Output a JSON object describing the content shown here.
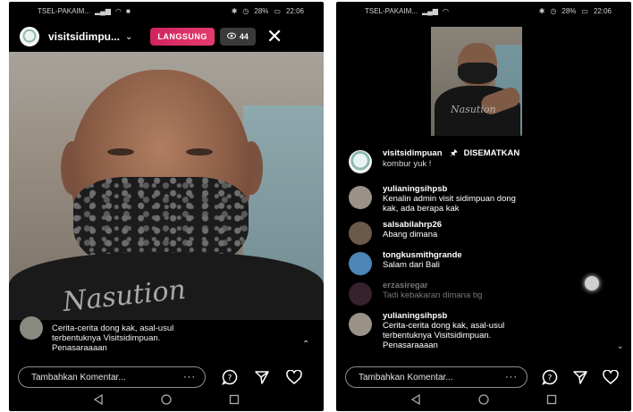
{
  "left": {
    "status": {
      "carrier": "TSEL-PAKAIM...",
      "battery": "28%",
      "time": "22:06"
    },
    "header": {
      "username": "visitsidimpu...",
      "live_label": "LANGSUNG",
      "viewer_count": "44"
    },
    "video": {
      "shirt_print": "Nasution"
    },
    "comment": {
      "text_line1": "Cerita-cerita dong kak, asal-usul",
      "text_line2": "terbentuknya Visitsidimpuan.",
      "text_line3": "Penasaraaaan"
    },
    "input": {
      "placeholder": "Tambahkan Komentar...",
      "more": "···"
    }
  },
  "right": {
    "status": {
      "carrier": "TSEL-PAKAIM...",
      "battery": "28%",
      "time": "22:06"
    },
    "thumb": {
      "shirt_print": "Nasution"
    },
    "pinned": {
      "username": "visitsidimpuan",
      "pin_label": "DISEMATKAN",
      "text": "kombur yuk !"
    },
    "comments": [
      {
        "user": "yulianingsihpsb",
        "line1": "Kenalin admin visit sidimpuan dong",
        "line2": "kak, ada berapa kak",
        "color": "#9a9287"
      },
      {
        "user": "salsabilahrp26",
        "line1": "Abang dimana",
        "line2": "",
        "color": "#6b5a4a"
      },
      {
        "user": "tongkusmithgrande",
        "line1": "Salam dari Bali",
        "line2": "",
        "color": "#4d86b5"
      },
      {
        "user": "erzasiregar",
        "line1": "Tadi kebakaran dimana bg",
        "line2": "",
        "color": "#7a4a63"
      },
      {
        "user": "yulianingsihpsb",
        "line1": "Cerita-cerita dong kak, asal-usul",
        "line2": "terbentuknya Visitsidimpuan.",
        "line3": "Penasaraaaan",
        "color": "#9a9287"
      }
    ],
    "input": {
      "placeholder": "Tambahkan Komentar...",
      "more": "···"
    }
  }
}
